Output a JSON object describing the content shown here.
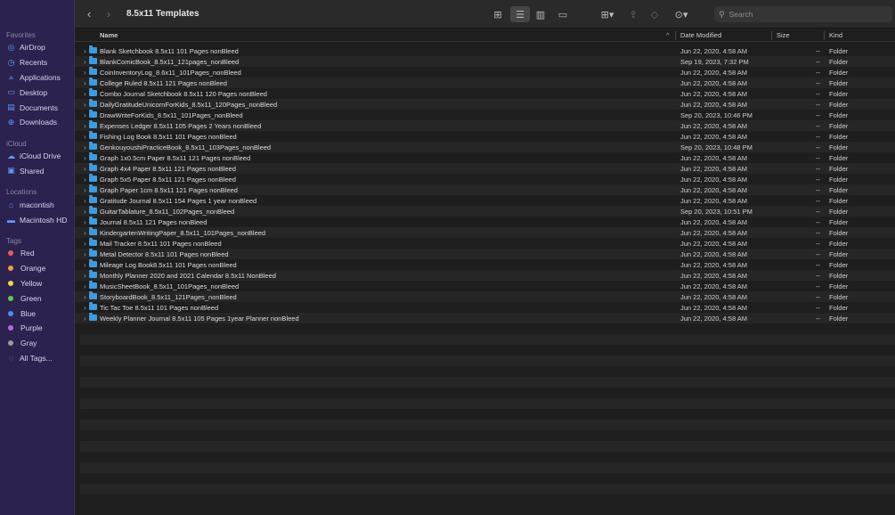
{
  "toolbar": {
    "back": "‹",
    "forward": "›",
    "title": "8.5x11 Templates",
    "search_placeholder": "Search"
  },
  "sidebar": {
    "favorites_label": "Favorites",
    "favorites": [
      {
        "label": "AirDrop",
        "icon": "airdrop-icon",
        "glyph": "◎"
      },
      {
        "label": "Recents",
        "icon": "clock-icon",
        "glyph": "◷"
      },
      {
        "label": "Applications",
        "icon": "applications-icon",
        "glyph": "⟑"
      },
      {
        "label": "Desktop",
        "icon": "desktop-icon",
        "glyph": "▭"
      },
      {
        "label": "Documents",
        "icon": "document-icon",
        "glyph": "▤"
      },
      {
        "label": "Downloads",
        "icon": "download-icon",
        "glyph": "⊕"
      }
    ],
    "icloud_label": "iCloud",
    "icloud": [
      {
        "label": "iCloud Drive",
        "icon": "cloud-icon",
        "glyph": "☁"
      },
      {
        "label": "Shared",
        "icon": "shared-folder-icon",
        "glyph": "▣"
      }
    ],
    "locations_label": "Locations",
    "locations": [
      {
        "label": "macontish",
        "icon": "computer-icon",
        "glyph": "⌂"
      },
      {
        "label": "Macintosh HD",
        "icon": "disk-icon",
        "glyph": "▬"
      }
    ],
    "tags_label": "Tags",
    "tags": [
      {
        "label": "Red",
        "color": "#ec5b56"
      },
      {
        "label": "Orange",
        "color": "#f0a03a"
      },
      {
        "label": "Yellow",
        "color": "#f5d547"
      },
      {
        "label": "Green",
        "color": "#5fc65a"
      },
      {
        "label": "Blue",
        "color": "#4a8df0"
      },
      {
        "label": "Purple",
        "color": "#b36ee0"
      },
      {
        "label": "Gray",
        "color": "#9a9a9a"
      }
    ],
    "all_tags": "All Tags..."
  },
  "columns": {
    "name": "Name",
    "date": "Date Modified",
    "size": "Size",
    "kind": "Kind"
  },
  "files": [
    {
      "name": "Blank Sketchbook 8.5x11 101 Pages nonBleed",
      "date": "Jun 22, 2020, 4:58 AM",
      "size": "--",
      "kind": "Folder"
    },
    {
      "name": "BlankComicBook_8.5x11_121pages_nonBleed",
      "date": "Sep 19, 2023, 7:32 PM",
      "size": "--",
      "kind": "Folder"
    },
    {
      "name": "CoinInventoryLog_8.6x11_101Pages_nonBleed",
      "date": "Jun 22, 2020, 4:58 AM",
      "size": "--",
      "kind": "Folder"
    },
    {
      "name": "College Ruled 8.5x11 121 Pages nonBleed",
      "date": "Jun 22, 2020, 4:58 AM",
      "size": "--",
      "kind": "Folder"
    },
    {
      "name": "Combo Journal Sketchbook 8.5x11 120 Pages nonBleed",
      "date": "Jun 22, 2020, 4:58 AM",
      "size": "--",
      "kind": "Folder"
    },
    {
      "name": "DailyGratitudeUnicornForKids_8.5x11_120Pages_nonBleed",
      "date": "Jun 22, 2020, 4:58 AM",
      "size": "--",
      "kind": "Folder"
    },
    {
      "name": "DrawWriteForKids_8.5x11_101Pages_nonBleed",
      "date": "Sep 20, 2023, 10:46 PM",
      "size": "--",
      "kind": "Folder"
    },
    {
      "name": "Expenses Ledger 8.5x11 105 Pages 2 Years nonBleed",
      "date": "Jun 22, 2020, 4:58 AM",
      "size": "--",
      "kind": "Folder"
    },
    {
      "name": "Fishing Log Book 8.5x11 101 Pages nonBleed",
      "date": "Jun 22, 2020, 4:58 AM",
      "size": "--",
      "kind": "Folder"
    },
    {
      "name": "GenkouyoushiPracticeBook_8.5x11_103Pages_nonBleed",
      "date": "Sep 20, 2023, 10:48 PM",
      "size": "--",
      "kind": "Folder"
    },
    {
      "name": "Graph 1x0.5cm Paper 8.5x11 121 Pages nonBleed",
      "date": "Jun 22, 2020, 4:58 AM",
      "size": "--",
      "kind": "Folder"
    },
    {
      "name": "Graph 4x4 Paper 8.5x11 121 Pages nonBleed",
      "date": "Jun 22, 2020, 4:58 AM",
      "size": "--",
      "kind": "Folder"
    },
    {
      "name": "Graph 5x5 Paper 8.5x11 121 Pages nonBleed",
      "date": "Jun 22, 2020, 4:58 AM",
      "size": "--",
      "kind": "Folder"
    },
    {
      "name": "Graph Paper 1cm 8.5x11 121 Pages nonBleed",
      "date": "Jun 22, 2020, 4:58 AM",
      "size": "--",
      "kind": "Folder"
    },
    {
      "name": "Gratitude Journal 8.5x11 154 Pages 1 year nonBleed",
      "date": "Jun 22, 2020, 4:58 AM",
      "size": "--",
      "kind": "Folder"
    },
    {
      "name": "GuitarTablature_8.5x11_102Pages_nonBleed",
      "date": "Sep 20, 2023, 10:51 PM",
      "size": "--",
      "kind": "Folder"
    },
    {
      "name": "Journal 8.5x11 121 Pages nonBleed",
      "date": "Jun 22, 2020, 4:58 AM",
      "size": "--",
      "kind": "Folder"
    },
    {
      "name": "KindergartenWritingPaper_8.5x11_101Pages_nonBleed",
      "date": "Jun 22, 2020, 4:58 AM",
      "size": "--",
      "kind": "Folder"
    },
    {
      "name": "Mail Tracker 8.5x11 101 Pages nonBleed",
      "date": "Jun 22, 2020, 4:58 AM",
      "size": "--",
      "kind": "Folder"
    },
    {
      "name": "Metal Detector 8.5x11 101 Pages nonBleed",
      "date": "Jun 22, 2020, 4:58 AM",
      "size": "--",
      "kind": "Folder"
    },
    {
      "name": "Mileage Log Book8.5x11 101 Pages nonBleed",
      "date": "Jun 22, 2020, 4:58 AM",
      "size": "--",
      "kind": "Folder"
    },
    {
      "name": "Monthly Planner 2020 and 2021 Calendar 8.5x11 NonBleed",
      "date": "Jun 22, 2020, 4:58 AM",
      "size": "--",
      "kind": "Folder"
    },
    {
      "name": "MusicSheetBook_8.5x11_101Pages_nonBleed",
      "date": "Jun 22, 2020, 4:58 AM",
      "size": "--",
      "kind": "Folder"
    },
    {
      "name": "StoryboardBook_8.5x11_121Pages_nonBleed",
      "date": "Jun 22, 2020, 4:58 AM",
      "size": "--",
      "kind": "Folder"
    },
    {
      "name": "Tic Tac Toe 8.5x11 101 Pages nonBleed",
      "date": "Jun 22, 2020, 4:58 AM",
      "size": "--",
      "kind": "Folder"
    },
    {
      "name": "Weekly Planner Journal 8.5x11 105 Pages 1year Planner nonBleed",
      "date": "Jun 22, 2020, 4:58 AM",
      "size": "--",
      "kind": "Folder"
    }
  ]
}
